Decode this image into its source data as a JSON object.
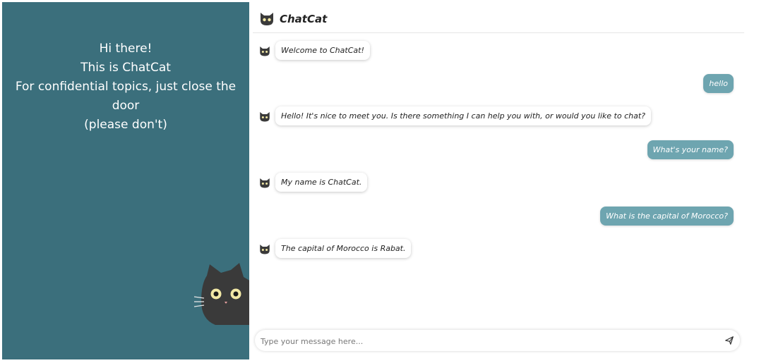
{
  "sidebar": {
    "intro_lines": [
      "Hi there!",
      "This is ChatCat",
      "For confidential topics, just close the",
      "door",
      "(please don't)"
    ]
  },
  "header": {
    "title": "ChatCat"
  },
  "messages": [
    {
      "role": "bot",
      "text": "Welcome to ChatCat!"
    },
    {
      "role": "user",
      "text": "hello"
    },
    {
      "role": "bot",
      "text": "Hello! It's nice to meet you. Is there something I can help you with, or would you like to chat?"
    },
    {
      "role": "user",
      "text": "What's your name?"
    },
    {
      "role": "bot",
      "text": "My name is ChatCat."
    },
    {
      "role": "user",
      "text": "What is the capital of Morocco?"
    },
    {
      "role": "bot",
      "text": "The capital of Morocco is Rabat."
    }
  ],
  "composer": {
    "placeholder": "Type your message here...",
    "send_icon": "send-icon"
  },
  "colors": {
    "sidebar_bg": "#3b6f7c",
    "user_bubble": "#6ea5b0",
    "cat": "#3a3a3a",
    "cat_eyes": "#f3e9a6"
  }
}
